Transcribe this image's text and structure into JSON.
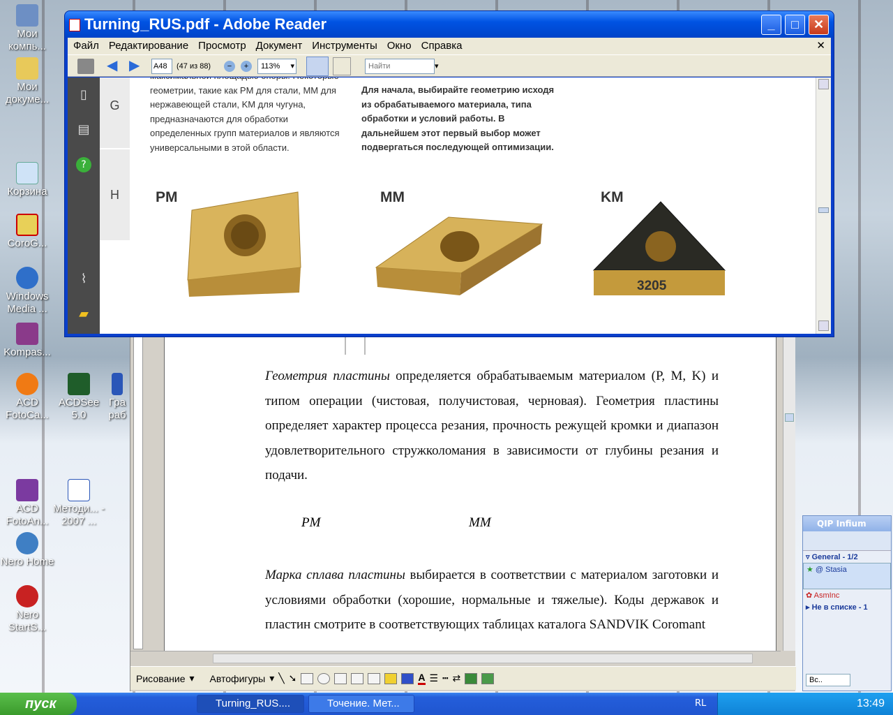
{
  "desktop": {
    "icons": [
      {
        "label": "Мои компь...",
        "id": "my-computer"
      },
      {
        "label": "Мои докуме...",
        "id": "my-documents"
      },
      {
        "label": "Корзина",
        "id": "recycle-bin"
      },
      {
        "label": "CoroG...",
        "id": "corog"
      },
      {
        "label": "Windows Media ...",
        "id": "windows-media"
      },
      {
        "label": "Kompas...",
        "id": "kompas"
      },
      {
        "label": "ACD FotoCa...",
        "id": "acd-fotocanvas"
      },
      {
        "label": "ACDSee 5.0",
        "id": "acdsee"
      },
      {
        "label": "Гра раб",
        "id": "gra"
      },
      {
        "label": "ACD FotoAn...",
        "id": "acd-fotoangelo"
      },
      {
        "label": "Методи... - 2007 ...",
        "id": "metodi"
      },
      {
        "label": "Nero Home",
        "id": "nero-home"
      },
      {
        "label": "Nero StartS...",
        "id": "nero-starts"
      }
    ]
  },
  "reader": {
    "title": "Turning_RUS.pdf - Adobe Reader",
    "menu": [
      "Файл",
      "Редактирование",
      "Просмотр",
      "Документ",
      "Инструменты",
      "Окно",
      "Справка"
    ],
    "page_field": "A48",
    "page_count": "(47 из 88)",
    "zoom": "113%",
    "find_placeholder": "Найти",
    "doc": {
      "row_g": "G",
      "row_h": "H",
      "left_text": "максимальной площадью опоры. Некоторые геометрии, такие как PM для стали, MM для нержавеющей стали, KM для чугуна, предназначаются для обработки определенных групп материалов и являются универсальными в этой области.",
      "right_text": "Для начала, выбирайте геометрию исходя из обрабатываемого материала, типа обработки и условий работы. В дальнейшем этот первый выбор может подвергаться последующей оптимизации.",
      "inserts": [
        {
          "label": "PM"
        },
        {
          "label": "MM"
        },
        {
          "label": "KM",
          "marking": "3205"
        }
      ]
    }
  },
  "word": {
    "para1_italic": "Геометрия пластины",
    "para1_rest": " определяется обрабатываемым материалом (P, M, K) и  типом операции (чистовая, получистовая, черновая). Геометрия пластины определяет характер процесса резания, прочность режущей кромки и диапазон удовлетворительного стружколомания в зависимости от глубины резания и подачи.",
    "label_pm": "PM",
    "label_mm": "MM",
    "para2_italic": "Марка сплава пластины",
    "para2_rest": " выбирается в соответствии с материалом заготовки и  условиями обработки (хорошие, нормальные и тяжелые). Коды державок  и пластин смотрите в соответствующих таблицах каталога SANDVIK Coromant",
    "draw_toolbar": {
      "drawing": "Рисование",
      "autoshapes": "Автофигуры"
    }
  },
  "qip": {
    "title": "QIP Infium",
    "group": "General - 1/2",
    "contact1": "Stasia",
    "contact2": "AsmInc",
    "not_in_list": "Не в списке - 1",
    "all_button": "Вс.."
  },
  "taskbar": {
    "start": "пуск",
    "tasks": [
      "Turning_RUS....",
      "Точение. Мет..."
    ],
    "lang": "RL",
    "clock": "13:49"
  },
  "colors": {
    "xp_blue": "#0053e3",
    "insert_gold": "#c9a24a",
    "start_green": "#3a9a2c"
  }
}
